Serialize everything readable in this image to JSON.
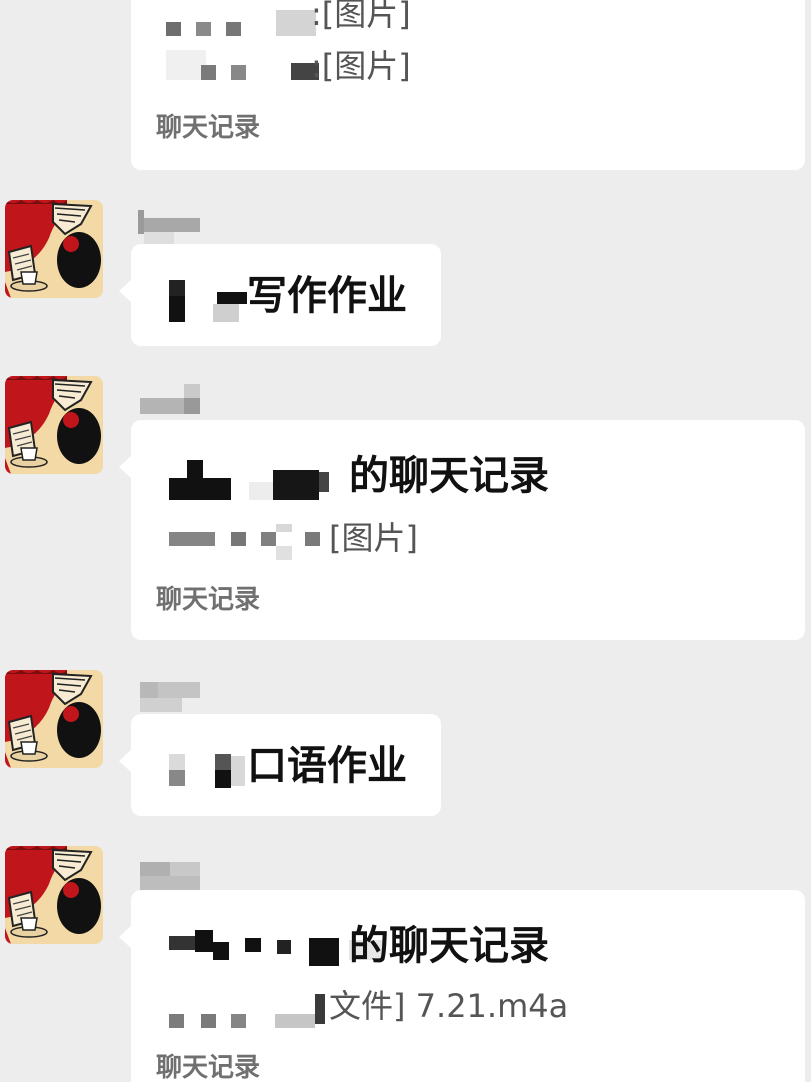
{
  "colors": {
    "background": "#ededed",
    "bubble": "#ffffff",
    "text_primary": "#111111",
    "text_secondary": "#555555",
    "card_label": "#707070",
    "avatar_red": "#c0161b",
    "avatar_cream": "#f3d9a6"
  },
  "messages": [
    {
      "type": "chat-record-card",
      "lines": [
        ":[图片]",
        ":[图片]"
      ],
      "label": "聊天记录"
    },
    {
      "type": "text",
      "avatar_icon": "cartoon-avatar-icon",
      "text": "写作作业"
    },
    {
      "type": "chat-record-card",
      "avatar_icon": "cartoon-avatar-icon",
      "title": "的聊天记录",
      "lines": [
        "[图片]"
      ],
      "label": "聊天记录"
    },
    {
      "type": "text",
      "avatar_icon": "cartoon-avatar-icon",
      "text": "口语作业"
    },
    {
      "type": "chat-record-card",
      "avatar_icon": "cartoon-avatar-icon",
      "title": "的聊天记录",
      "lines": [
        "文件] 7.21.m4a"
      ],
      "label": "聊天记录"
    }
  ]
}
